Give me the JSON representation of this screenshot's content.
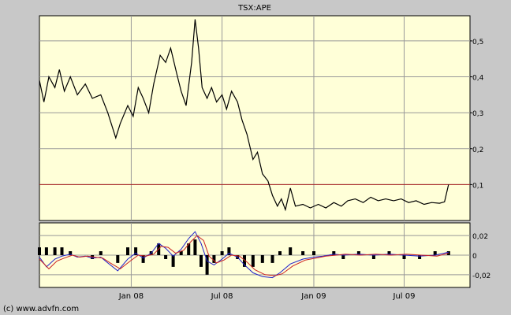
{
  "chart_data": [
    {
      "type": "line",
      "title": "TSX:APE",
      "x_range": [
        "2007-07-01",
        "2009-11-10"
      ],
      "y_range": [
        0.0,
        0.57
      ],
      "y_ticks": [
        {
          "value": 0.5,
          "label": "0,5"
        },
        {
          "value": 0.4,
          "label": "0,4"
        },
        {
          "value": 0.3,
          "label": "0,3"
        },
        {
          "value": 0.2,
          "label": "0,2"
        },
        {
          "value": 0.1,
          "label": "0,1"
        }
      ],
      "x_ticks": [
        {
          "date": "2008-01-01",
          "label": "Jan 08"
        },
        {
          "date": "2008-07-01",
          "label": "Jul 08"
        },
        {
          "date": "2009-01-01",
          "label": "Jan 09"
        },
        {
          "date": "2009-07-01",
          "label": "Jul 09"
        }
      ],
      "reference_line": {
        "value": 0.1,
        "color": "#aa2222"
      },
      "grid": true,
      "background": "#ffffd8",
      "series": [
        {
          "color": "#000000",
          "points": [
            [
              "2007-07-01",
              0.39
            ],
            [
              "2007-07-10",
              0.33
            ],
            [
              "2007-07-20",
              0.4
            ],
            [
              "2007-08-01",
              0.37
            ],
            [
              "2007-08-10",
              0.42
            ],
            [
              "2007-08-20",
              0.36
            ],
            [
              "2007-09-01",
              0.4
            ],
            [
              "2007-09-15",
              0.35
            ],
            [
              "2007-10-01",
              0.38
            ],
            [
              "2007-10-15",
              0.34
            ],
            [
              "2007-11-01",
              0.35
            ],
            [
              "2007-11-15",
              0.3
            ],
            [
              "2007-12-01",
              0.23
            ],
            [
              "2007-12-10",
              0.27
            ],
            [
              "2007-12-25",
              0.32
            ],
            [
              "2008-01-05",
              0.29
            ],
            [
              "2008-01-15",
              0.37
            ],
            [
              "2008-01-25",
              0.34
            ],
            [
              "2008-02-05",
              0.3
            ],
            [
              "2008-02-15",
              0.38
            ],
            [
              "2008-02-28",
              0.46
            ],
            [
              "2008-03-10",
              0.44
            ],
            [
              "2008-03-20",
              0.48
            ],
            [
              "2008-04-01",
              0.41
            ],
            [
              "2008-04-10",
              0.36
            ],
            [
              "2008-04-20",
              0.32
            ],
            [
              "2008-05-01",
              0.44
            ],
            [
              "2008-05-08",
              0.56
            ],
            [
              "2008-05-15",
              0.48
            ],
            [
              "2008-05-22",
              0.37
            ],
            [
              "2008-06-01",
              0.34
            ],
            [
              "2008-06-10",
              0.37
            ],
            [
              "2008-06-20",
              0.33
            ],
            [
              "2008-07-01",
              0.35
            ],
            [
              "2008-07-10",
              0.31
            ],
            [
              "2008-07-20",
              0.36
            ],
            [
              "2008-08-01",
              0.33
            ],
            [
              "2008-08-10",
              0.28
            ],
            [
              "2008-08-20",
              0.24
            ],
            [
              "2008-09-01",
              0.17
            ],
            [
              "2008-09-10",
              0.19
            ],
            [
              "2008-09-20",
              0.13
            ],
            [
              "2008-10-01",
              0.11
            ],
            [
              "2008-10-10",
              0.07
            ],
            [
              "2008-10-20",
              0.04
            ],
            [
              "2008-10-28",
              0.06
            ],
            [
              "2008-11-05",
              0.03
            ],
            [
              "2008-11-15",
              0.09
            ],
            [
              "2008-11-25",
              0.04
            ],
            [
              "2008-12-10",
              0.045
            ],
            [
              "2008-12-25",
              0.035
            ],
            [
              "2009-01-10",
              0.045
            ],
            [
              "2009-01-25",
              0.035
            ],
            [
              "2009-02-10",
              0.05
            ],
            [
              "2009-02-25",
              0.04
            ],
            [
              "2009-03-10",
              0.055
            ],
            [
              "2009-03-25",
              0.06
            ],
            [
              "2009-04-10",
              0.05
            ],
            [
              "2009-04-25",
              0.065
            ],
            [
              "2009-05-10",
              0.055
            ],
            [
              "2009-05-25",
              0.06
            ],
            [
              "2009-06-10",
              0.055
            ],
            [
              "2009-06-25",
              0.06
            ],
            [
              "2009-07-10",
              0.05
            ],
            [
              "2009-07-25",
              0.055
            ],
            [
              "2009-08-10",
              0.045
            ],
            [
              "2009-08-25",
              0.05
            ],
            [
              "2009-09-10",
              0.048
            ],
            [
              "2009-09-20",
              0.052
            ],
            [
              "2009-09-28",
              0.1
            ]
          ]
        }
      ]
    },
    {
      "type": "line",
      "x_range": [
        "2007-07-01",
        "2009-11-10"
      ],
      "y_range": [
        -0.033,
        0.033
      ],
      "y_ticks": [
        {
          "value": 0.02,
          "label": "0,02"
        },
        {
          "value": 0,
          "label": "0"
        },
        {
          "value": -0.02,
          "label": "-0,02"
        }
      ],
      "grid": true,
      "background": "#ffffd8",
      "series": [
        {
          "color": "#2222cc",
          "points": [
            [
              "2007-07-01",
              -0.002
            ],
            [
              "2007-07-15",
              -0.012
            ],
            [
              "2007-08-01",
              -0.004
            ],
            [
              "2007-08-15",
              -0.001
            ],
            [
              "2007-09-01",
              0.001
            ],
            [
              "2007-09-15",
              -0.002
            ],
            [
              "2007-10-01",
              -0.001
            ],
            [
              "2007-10-15",
              -0.003
            ],
            [
              "2007-11-01",
              -0.002
            ],
            [
              "2007-11-15",
              -0.008
            ],
            [
              "2007-12-05",
              -0.016
            ],
            [
              "2007-12-25",
              -0.004
            ],
            [
              "2008-01-10",
              0.002
            ],
            [
              "2008-01-25",
              -0.003
            ],
            [
              "2008-02-10",
              0.002
            ],
            [
              "2008-02-25",
              0.012
            ],
            [
              "2008-03-10",
              0.007
            ],
            [
              "2008-03-25",
              -0.001
            ],
            [
              "2008-04-10",
              0.006
            ],
            [
              "2008-04-25",
              0.017
            ],
            [
              "2008-05-08",
              0.024
            ],
            [
              "2008-05-20",
              0.012
            ],
            [
              "2008-06-01",
              -0.006
            ],
            [
              "2008-06-15",
              -0.01
            ],
            [
              "2008-07-01",
              -0.004
            ],
            [
              "2008-07-15",
              0.002
            ],
            [
              "2008-08-01",
              -0.002
            ],
            [
              "2008-08-15",
              -0.01
            ],
            [
              "2008-09-01",
              -0.018
            ],
            [
              "2008-09-20",
              -0.022
            ],
            [
              "2008-10-10",
              -0.023
            ],
            [
              "2008-10-25",
              -0.018
            ],
            [
              "2008-11-15",
              -0.009
            ],
            [
              "2008-12-10",
              -0.004
            ],
            [
              "2009-01-01",
              -0.002
            ],
            [
              "2009-01-20",
              -0.001
            ],
            [
              "2009-02-10",
              0.001
            ],
            [
              "2009-03-01",
              0.0
            ],
            [
              "2009-04-01",
              0.001
            ],
            [
              "2009-05-01",
              0.0
            ],
            [
              "2009-06-01",
              0.001
            ],
            [
              "2009-07-01",
              0.0
            ],
            [
              "2009-08-01",
              -0.001
            ],
            [
              "2009-09-01",
              0.0
            ],
            [
              "2009-09-28",
              0.003
            ]
          ]
        },
        {
          "color": "#cc2222",
          "points": [
            [
              "2007-07-01",
              -0.004
            ],
            [
              "2007-07-20",
              -0.014
            ],
            [
              "2007-08-05",
              -0.006
            ],
            [
              "2007-08-20",
              -0.003
            ],
            [
              "2007-09-05",
              0.0
            ],
            [
              "2007-09-20",
              -0.002
            ],
            [
              "2007-10-05",
              -0.001
            ],
            [
              "2007-10-20",
              -0.002
            ],
            [
              "2007-11-05",
              -0.003
            ],
            [
              "2007-11-20",
              -0.008
            ],
            [
              "2007-12-10",
              -0.014
            ],
            [
              "2007-12-30",
              -0.006
            ],
            [
              "2008-01-15",
              0.0
            ],
            [
              "2008-01-30",
              -0.001
            ],
            [
              "2008-02-15",
              0.001
            ],
            [
              "2008-03-01",
              0.009
            ],
            [
              "2008-03-15",
              0.008
            ],
            [
              "2008-03-30",
              0.002
            ],
            [
              "2008-04-15",
              0.005
            ],
            [
              "2008-04-30",
              0.014
            ],
            [
              "2008-05-12",
              0.02
            ],
            [
              "2008-05-25",
              0.015
            ],
            [
              "2008-06-05",
              -0.001
            ],
            [
              "2008-06-20",
              -0.008
            ],
            [
              "2008-07-05",
              -0.005
            ],
            [
              "2008-07-20",
              0.0
            ],
            [
              "2008-08-05",
              -0.001
            ],
            [
              "2008-08-20",
              -0.007
            ],
            [
              "2008-09-05",
              -0.015
            ],
            [
              "2008-09-25",
              -0.02
            ],
            [
              "2008-10-15",
              -0.021
            ],
            [
              "2008-10-30",
              -0.019
            ],
            [
              "2008-11-20",
              -0.011
            ],
            [
              "2008-12-15",
              -0.005
            ],
            [
              "2009-01-05",
              -0.003
            ],
            [
              "2009-01-25",
              -0.001
            ],
            [
              "2009-02-15",
              0.0
            ],
            [
              "2009-03-05",
              0.001
            ],
            [
              "2009-04-05",
              0.0
            ],
            [
              "2009-05-05",
              0.001
            ],
            [
              "2009-06-05",
              0.0
            ],
            [
              "2009-07-05",
              0.001
            ],
            [
              "2009-08-05",
              0.0
            ],
            [
              "2009-09-05",
              -0.001
            ],
            [
              "2009-09-28",
              0.002
            ]
          ]
        }
      ]
    }
  ],
  "footer": {
    "copyright": "(c) www.advfn.com"
  }
}
